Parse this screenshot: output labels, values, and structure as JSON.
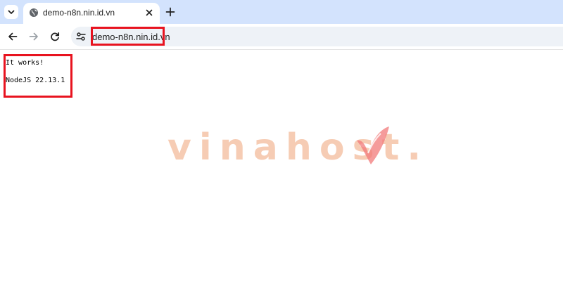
{
  "browser": {
    "tab": {
      "title": "demo-n8n.nin.id.vn"
    },
    "address_bar": {
      "url": "demo-n8n.nin.id.vn"
    }
  },
  "page": {
    "lines": [
      "It works!",
      "NodeJS 22.13.1"
    ]
  },
  "watermark": {
    "text": "vinahost."
  },
  "colors": {
    "tabstrip": "#d3e3fd",
    "highlight": "#e8131f",
    "watermark_text": "#f5c4a8",
    "watermark_logo": "#f27a7a"
  },
  "icons": {
    "tab_search": "chevron-down-icon",
    "favicon": "globe-icon",
    "tab_close": "close-icon",
    "new_tab": "plus-icon",
    "back": "arrow-left-icon",
    "forward": "arrow-right-icon",
    "reload": "reload-icon",
    "site_info": "tune-icon"
  }
}
